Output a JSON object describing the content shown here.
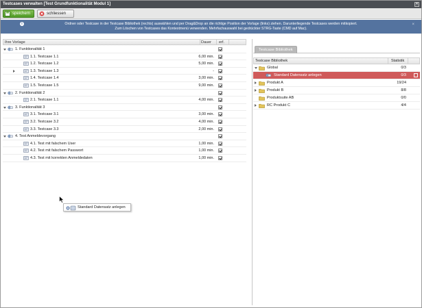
{
  "window": {
    "title": "Testcases verwalten [Test Grundfunktionalität Modul 1]",
    "close_icon": "close-x-icon"
  },
  "toolbar": {
    "save_label": "speichern",
    "close_label": "schliessen"
  },
  "info": {
    "line1": "Ordner oder Testcase in der Testcase Bibliothek (rechts) auswählen und per Drag&Drop an die richtige Position der Vorlage (links) ziehen. Darunterliegende Testcases werden mitkopiert.",
    "line2": "Zum Löschen von Testcases das Kontextmenü verwenden. Mehrfachauswahl bei gedrückter STRG-Taste (CMD auf Mac).",
    "close": "×"
  },
  "left_grid": {
    "col_vorlage": "Ihre Vorlage",
    "col_dauer": "Dauer",
    "col_erf": "erf.",
    "rows": [
      {
        "label": "1. Funktionalität 1",
        "dur": "",
        "level": 0,
        "type": "group",
        "expander": "down"
      },
      {
        "label": "1.1. Testcase 1.1",
        "dur": "6,00 min.",
        "level": 1,
        "type": "case",
        "expander": ""
      },
      {
        "label": "1.2. Testcase 1.2",
        "dur": "5,00 min.",
        "level": 1,
        "type": "case",
        "expander": ""
      },
      {
        "label": "1.3. Testcase 1.3",
        "dur": "-",
        "level": 1,
        "type": "case-group",
        "expander": "right"
      },
      {
        "label": "1.4. Testcase 1.4",
        "dur": "3,00 min.",
        "level": 1,
        "type": "case",
        "expander": ""
      },
      {
        "label": "1.5. Testcase 1.5",
        "dur": "9,00 min.",
        "level": 1,
        "type": "case",
        "expander": ""
      },
      {
        "label": "2. Funktionalität 2",
        "dur": "",
        "level": 0,
        "type": "group",
        "expander": "down"
      },
      {
        "label": "2.1. Testcase 1.1",
        "dur": "4,00 min.",
        "level": 1,
        "type": "case",
        "expander": ""
      },
      {
        "label": "3. Funktionalität 3",
        "dur": "",
        "level": 0,
        "type": "group",
        "expander": "down"
      },
      {
        "label": "3.1. Testcase 3.1",
        "dur": "3,00 min.",
        "level": 1,
        "type": "case",
        "expander": ""
      },
      {
        "label": "3.2. Testcase 3.2",
        "dur": "4,00 min.",
        "level": 1,
        "type": "case",
        "expander": ""
      },
      {
        "label": "3.3. Testcase 3.3",
        "dur": "2,00 min.",
        "level": 1,
        "type": "case",
        "expander": ""
      },
      {
        "label": "4. Test Anmeldevorgang",
        "dur": "",
        "level": 0,
        "type": "group",
        "expander": "down"
      },
      {
        "label": "4.1. Test mit falschem User",
        "dur": "1,00 min.",
        "level": 1,
        "type": "case",
        "expander": ""
      },
      {
        "label": "4.2. Test mit falschem Passwort",
        "dur": "1,00 min.",
        "level": 1,
        "type": "case",
        "expander": ""
      },
      {
        "label": "4.3. Test mit korrekten Anmeldedaten",
        "dur": "1,00 min.",
        "level": 1,
        "type": "case",
        "expander": ""
      }
    ]
  },
  "drag_tooltip": {
    "label": "Standard Datensatz anlegen"
  },
  "right_panel": {
    "tab_label": "Testcase Bibliothek",
    "col_name": "Testcase Bibliothek",
    "col_stat": "Statistik",
    "rows": [
      {
        "label": "Global",
        "stat": "0/3",
        "level": 0,
        "expander": "down",
        "selected": false,
        "icon": "folder-open"
      },
      {
        "label": "Standard Datensatz anlegen",
        "stat": "0/3",
        "level": 1,
        "expander": "",
        "selected": true,
        "icon": "testcase"
      },
      {
        "label": "Produkt A",
        "stat": "19/24",
        "level": 0,
        "expander": "right",
        "selected": false,
        "icon": "folder"
      },
      {
        "label": "Produkt B",
        "stat": "8/8",
        "level": 0,
        "expander": "right",
        "selected": false,
        "icon": "folder"
      },
      {
        "label": "Produktsuite AB",
        "stat": "0/0",
        "level": 0,
        "expander": "",
        "selected": false,
        "icon": "folder"
      },
      {
        "label": "RC Produkt C",
        "stat": "4/4",
        "level": 0,
        "expander": "right",
        "selected": false,
        "icon": "folder"
      }
    ]
  },
  "colors": {
    "titlebar": "#4b4e53",
    "info": "#54739f",
    "save": "#5fa833",
    "selected_row": "#cf5a5a",
    "folder": "#e2c35b"
  }
}
